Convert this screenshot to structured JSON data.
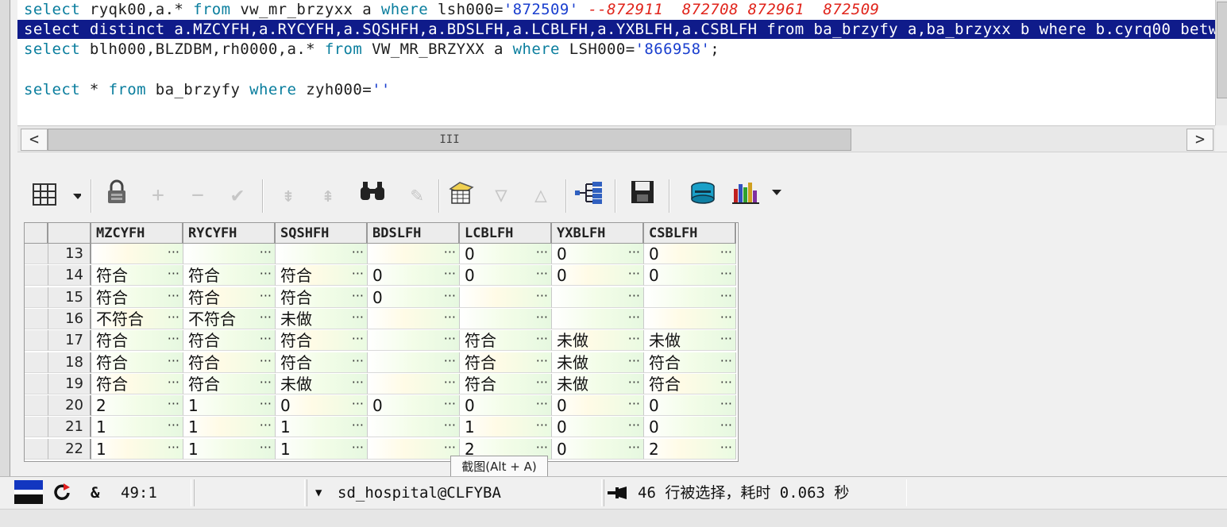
{
  "editor": {
    "lines": [
      {
        "parts": [
          [
            "kw",
            "select "
          ],
          [
            "id",
            "ryqk00,a.* "
          ],
          [
            "kw",
            "from "
          ],
          [
            "id",
            "vw_mr_brzyxx a "
          ],
          [
            "kw",
            "where "
          ],
          [
            "id",
            "lsh000="
          ],
          [
            "str",
            "'872509'"
          ],
          [
            "cm",
            " --872911  872708 872961  872509"
          ]
        ]
      },
      {
        "selected": true,
        "text": "select distinct a.MZCYFH,a.RYCYFH,a.SQSHFH,a.BDSLFH,a.LCBLFH,a.YXBLFH,a.CSBLFH from ba_brzyfy a,ba_brzyxx b where b.cyrq00 betw"
      },
      {
        "parts": [
          [
            "kw",
            "select "
          ],
          [
            "id",
            "blh000,BLZDBM,rh0000,a.* "
          ],
          [
            "kw",
            "from "
          ],
          [
            "id",
            "VW_MR_BRZYXX a "
          ],
          [
            "kw",
            "where "
          ],
          [
            "id",
            "LSH000="
          ],
          [
            "str",
            "'866958'"
          ],
          [
            "id",
            ";"
          ]
        ]
      },
      {
        "parts": []
      },
      {
        "parts": [
          [
            "kw",
            "select "
          ],
          [
            "id",
            "* "
          ],
          [
            "kw",
            "from "
          ],
          [
            "id",
            "ba_brzyfy "
          ],
          [
            "kw",
            "where "
          ],
          [
            "id",
            "zyh000="
          ],
          [
            "str",
            "''"
          ]
        ]
      }
    ]
  },
  "hscroll": {
    "left_arrow": "<",
    "right_arrow": ">",
    "grip": "III"
  },
  "toolbar": {
    "icons": [
      "grid-options-icon",
      "lock-icon",
      "add-record-icon",
      "delete-record-icon",
      "post-edit-icon",
      "filter-icon",
      "clear-filter-icon",
      "find-icon",
      "clear-icon",
      "query-by-example-icon",
      "sort-down-icon",
      "sort-up-icon",
      "tree-view-icon",
      "save-icon",
      "export-icon",
      "chart-icon"
    ]
  },
  "grid": {
    "columns": [
      "MZCYFH",
      "RYCYFH",
      "SQSHFH",
      "BDSLFH",
      "LCBLFH",
      "YXBLFH",
      "CSBLFH"
    ],
    "rows": [
      {
        "num": "13",
        "cells": [
          "",
          "",
          "",
          "",
          "0",
          "0",
          "0"
        ]
      },
      {
        "num": "14",
        "cells": [
          "符合",
          "符合",
          "符合",
          "0",
          "0",
          "0",
          "0"
        ]
      },
      {
        "num": "15",
        "cells": [
          "符合",
          "符合",
          "符合",
          "0",
          "",
          "",
          ""
        ]
      },
      {
        "num": "16",
        "cells": [
          "不符合",
          "不符合",
          "未做",
          "",
          "",
          "",
          ""
        ]
      },
      {
        "num": "17",
        "cells": [
          "符合",
          "符合",
          "符合",
          "",
          "符合",
          "未做",
          "未做"
        ]
      },
      {
        "num": "18",
        "cells": [
          "符合",
          "符合",
          "符合",
          "",
          "符合",
          "未做",
          "符合"
        ]
      },
      {
        "num": "19",
        "cells": [
          "符合",
          "符合",
          "未做",
          "",
          "符合",
          "未做",
          "符合"
        ]
      },
      {
        "num": "20",
        "cells": [
          "2",
          "1",
          "0",
          "0",
          "0",
          "0",
          "0"
        ]
      },
      {
        "num": "21",
        "cells": [
          "1",
          "1",
          "1",
          "",
          "1",
          "0",
          "0"
        ]
      },
      {
        "num": "22",
        "cells": [
          "1",
          "1",
          "1",
          "",
          "2",
          "0",
          "2"
        ]
      }
    ],
    "ellipsis": "···"
  },
  "tooltip": "截图(Alt + A)",
  "status": {
    "amp": "&",
    "position": "49:1",
    "connection_arrow": "▼",
    "connection": "sd_hospital@CLFYBA",
    "result": "46 行被选择，耗时 0.063 秒"
  }
}
